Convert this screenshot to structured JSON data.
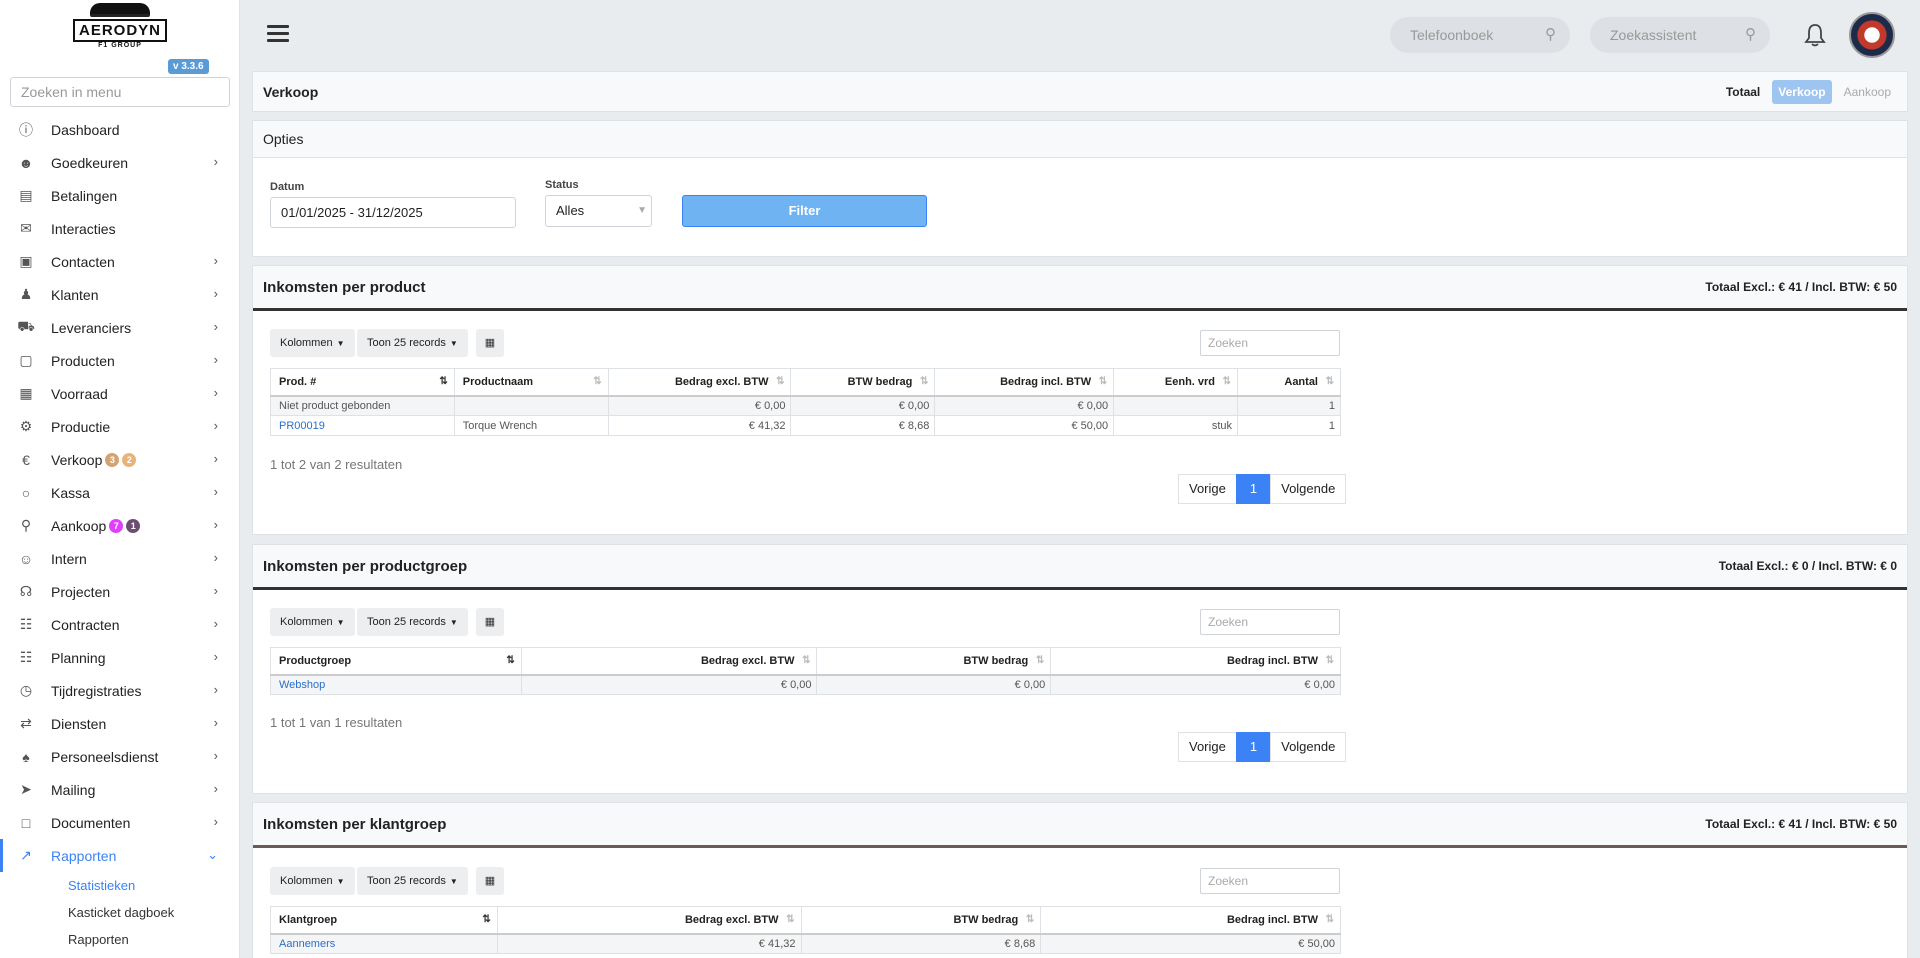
{
  "app": {
    "version": "v 3.3.6",
    "logo_text": "AERODYN",
    "logo_sub": "F1 GROUP",
    "menu_search_placeholder": "Zoeken in menu"
  },
  "sidebar": {
    "items": [
      {
        "label": "Dashboard",
        "icon": "dashboard-icon",
        "chevron": false
      },
      {
        "label": "Goedkeuren",
        "icon": "user-check-icon",
        "chevron": true
      },
      {
        "label": "Betalingen",
        "icon": "credit-card-icon",
        "chevron": false
      },
      {
        "label": "Interacties",
        "icon": "chat-icon",
        "chevron": false
      },
      {
        "label": "Contacten",
        "icon": "contact-card-icon",
        "chevron": true
      },
      {
        "label": "Klanten",
        "icon": "customer-icon",
        "chevron": true
      },
      {
        "label": "Leveranciers",
        "icon": "truck-icon",
        "chevron": true
      },
      {
        "label": "Producten",
        "icon": "box-icon",
        "chevron": true
      },
      {
        "label": "Voorraad",
        "icon": "boxes-icon",
        "chevron": true
      },
      {
        "label": "Productie",
        "icon": "gears-icon",
        "chevron": true
      },
      {
        "label": "Verkoop",
        "icon": "euro-icon",
        "chevron": true,
        "badges": [
          {
            "text": "3",
            "color": "#d4a373"
          },
          {
            "text": "2",
            "color": "#e9b27a"
          }
        ]
      },
      {
        "label": "Kassa",
        "icon": "basket-icon",
        "chevron": true
      },
      {
        "label": "Aankoop",
        "icon": "cart-icon",
        "chevron": true,
        "badges": [
          {
            "text": "7",
            "color": "#e040fb"
          },
          {
            "text": "1",
            "color": "#6c4f70"
          }
        ]
      },
      {
        "label": "Intern",
        "icon": "users-icon",
        "chevron": true
      },
      {
        "label": "Projecten",
        "icon": "project-icon",
        "chevron": true
      },
      {
        "label": "Contracten",
        "icon": "contract-icon",
        "chevron": true
      },
      {
        "label": "Planning",
        "icon": "calendar-icon",
        "chevron": true
      },
      {
        "label": "Tijdregistraties",
        "icon": "timer-icon",
        "chevron": true
      },
      {
        "label": "Diensten",
        "icon": "repeat-icon",
        "chevron": true
      },
      {
        "label": "Personeelsdienst",
        "icon": "staff-icon",
        "chevron": true
      },
      {
        "label": "Mailing",
        "icon": "send-icon",
        "chevron": true
      },
      {
        "label": "Documenten",
        "icon": "folder-icon",
        "chevron": true
      },
      {
        "label": "Rapporten",
        "icon": "chart-line-icon",
        "chevron": true,
        "active": true
      }
    ],
    "subitems": [
      {
        "label": "Statistieken",
        "active": true
      },
      {
        "label": "Kasticket dagboek"
      },
      {
        "label": "Rapporten"
      }
    ]
  },
  "topbar": {
    "phonebook_placeholder": "Telefoonboek",
    "assistant_placeholder": "Zoekassistent"
  },
  "header": {
    "title": "Verkoop",
    "tabs": [
      "Totaal",
      "Verkoop",
      "Aankoop"
    ]
  },
  "options": {
    "title": "Opties",
    "date_label": "Datum",
    "date_value": "01/01/2025 - 31/12/2025",
    "status_label": "Status",
    "status_value": "Alles",
    "filter_label": "Filter"
  },
  "toolbar": {
    "columns_label": "Kolommen",
    "show_label": "Toon 25 records",
    "search_placeholder": "Zoeken",
    "prev_label": "Vorige",
    "next_label": "Volgende",
    "page": "1"
  },
  "product": {
    "title": "Inkomsten per product",
    "total": "Totaal Excl.: € 41 / Incl. BTW: € 50",
    "headers": [
      "Prod. #",
      "Productnaam",
      "Bedrag excl. BTW",
      "BTW bedrag",
      "Bedrag incl. BTW",
      "Eenh. vrd",
      "Aantal"
    ],
    "rows": [
      [
        "Niet product gebonden",
        "",
        "€ 0,00",
        "€ 0,00",
        "€ 0,00",
        "",
        "1"
      ],
      [
        "PR00019",
        "Torque Wrench",
        "€ 41,32",
        "€ 8,68",
        "€ 50,00",
        "stuk",
        "1"
      ]
    ],
    "result": "1 tot 2 van 2 resultaten"
  },
  "productgroup": {
    "title": "Inkomsten per productgroep",
    "total": "Totaal Excl.: € 0 / Incl. BTW: € 0",
    "headers": [
      "Productgroep",
      "Bedrag excl. BTW",
      "BTW bedrag",
      "Bedrag incl. BTW"
    ],
    "rows": [
      [
        "Webshop",
        "€ 0,00",
        "€ 0,00",
        "€ 0,00"
      ]
    ],
    "result": "1 tot 1 van 1 resultaten"
  },
  "customergroup": {
    "title": "Inkomsten per klantgroep",
    "total": "Totaal Excl.: € 41 / Incl. BTW: € 50",
    "headers": [
      "Klantgroep",
      "Bedrag excl. BTW",
      "BTW bedrag",
      "Bedrag incl. BTW"
    ],
    "rows": [
      [
        "Aannemers",
        "€ 41,32",
        "€ 8,68",
        "€ 50,00"
      ]
    ]
  }
}
